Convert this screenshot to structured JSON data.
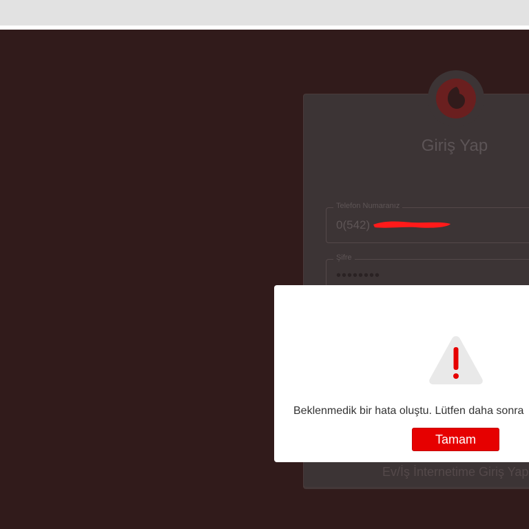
{
  "login": {
    "title": "Giriş Yap",
    "phone_label": "Telefon Numaranız",
    "phone_value": "0(542)",
    "password_label": "Şifre",
    "password_value": "••••••••",
    "bottom_button_label": "Ev/İş İnternetime Giriş Yap"
  },
  "dialog": {
    "icon": "warning-triangle-icon",
    "message": "Beklenmedik bir hata oluştu. Lütfen daha sonra",
    "ok_label": "Tamam"
  },
  "colors": {
    "brand_red": "#e60000",
    "overlay": "#311b1b",
    "card_dim": "#3c3435"
  }
}
